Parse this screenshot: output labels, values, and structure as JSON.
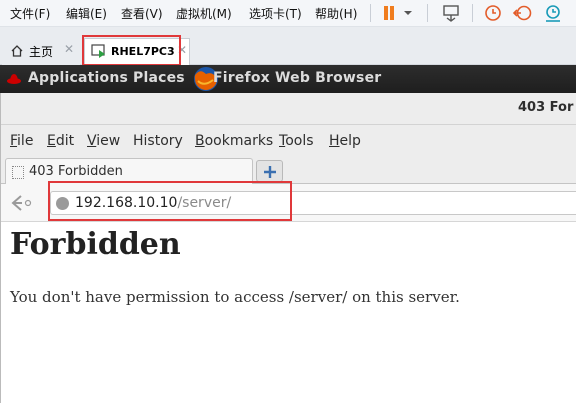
{
  "vmware": {
    "menu": [
      "文件(F)",
      "编辑(E)",
      "查看(V)",
      "虚拟机(M)",
      "选项卡(T)",
      "帮助(H)"
    ],
    "tabs": [
      {
        "label": "主页",
        "active": false
      },
      {
        "label": "RHEL7PC3",
        "active": true
      }
    ],
    "colors": {
      "pause": "#f07d1f",
      "highlight": "#e0383a",
      "snapshot": "#e35c2a",
      "fit": "#1a9bb8"
    }
  },
  "gnome_panel": {
    "applications": "Applications",
    "places": "Places",
    "app_title": "Firefox Web Browser"
  },
  "firefox": {
    "window_title": "403 For",
    "menu": [
      {
        "accel": "F",
        "rest": "ile"
      },
      {
        "accel": "E",
        "rest": "dit"
      },
      {
        "accel": "V",
        "rest": "iew"
      },
      {
        "accel": "",
        "rest": "History"
      },
      {
        "accel": "B",
        "rest": "ookmarks"
      },
      {
        "accel": "T",
        "rest": "ools"
      },
      {
        "accel": "H",
        "rest": "elp"
      }
    ],
    "tab_title": "403 Forbidden",
    "url": {
      "host": "192.168.10.10",
      "path": "/server/"
    },
    "page": {
      "heading": "Forbidden",
      "message": "You don't have permission to access /server/ on this server."
    }
  }
}
